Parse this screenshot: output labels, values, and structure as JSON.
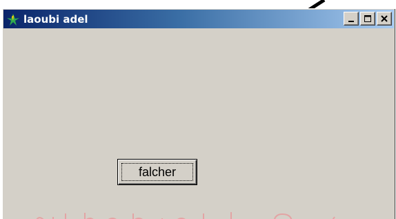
{
  "window": {
    "title": "laoubi adel",
    "icon": "app-logo-icon",
    "controls": {
      "minimize_icon": "minimize-icon",
      "maximize_icon": "maximize-icon",
      "close_icon": "close-icon"
    }
  },
  "main": {
    "button_label": "falcher"
  },
  "colors": {
    "face": "#d4d0c8",
    "title_start": "#0a246a",
    "title_end": "#a6caf0",
    "watermark": "#e0a0a0"
  }
}
